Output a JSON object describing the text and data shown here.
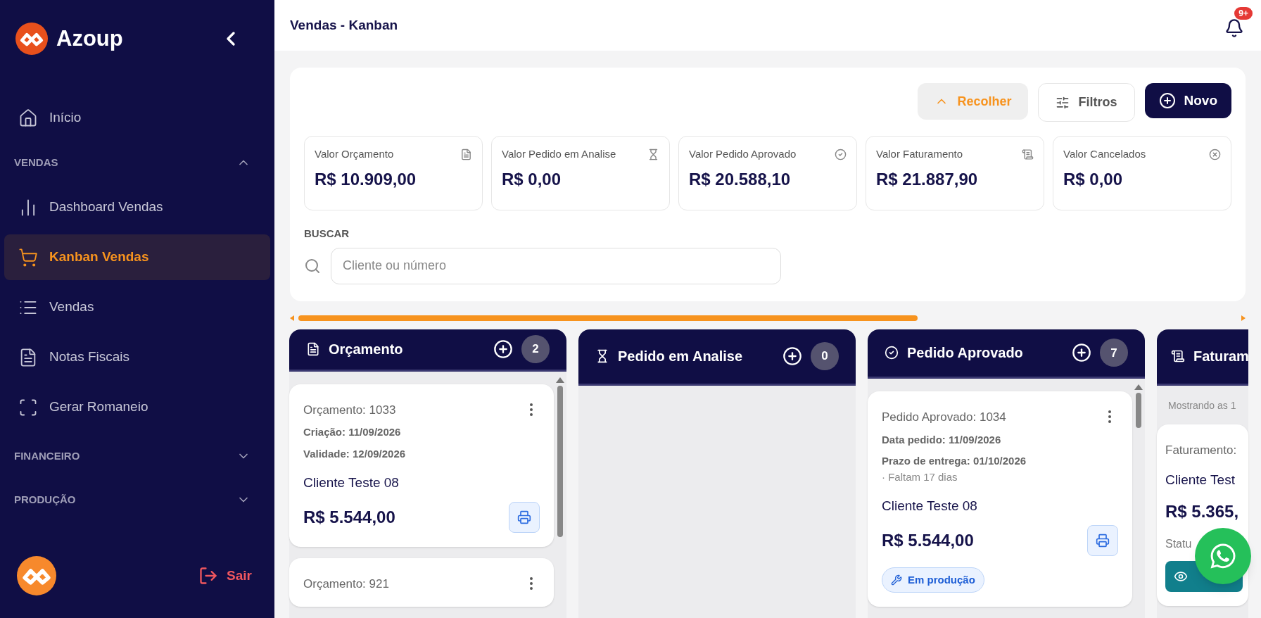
{
  "sidebar": {
    "brand": "Azoup",
    "top_items": [
      {
        "label": "Início",
        "selected": false
      }
    ],
    "sections": [
      {
        "title": "VENDAS",
        "expanded": true,
        "items": [
          {
            "label": "Dashboard Vendas",
            "selected": false
          },
          {
            "label": "Kanban Vendas",
            "selected": true
          },
          {
            "label": "Vendas",
            "selected": false
          },
          {
            "label": "Notas Fiscais",
            "selected": false
          },
          {
            "label": "Gerar Romaneio",
            "selected": false
          }
        ]
      },
      {
        "title": "FINANCEIRO",
        "expanded": false
      },
      {
        "title": "PRODUÇÃO",
        "expanded": false
      }
    ],
    "logout": "Sair"
  },
  "header": {
    "title": "Vendas - Kanban",
    "notifications_badge": "9+"
  },
  "toolbar": {
    "buttons": [
      {
        "label": "Recolher",
        "kind": "collapse"
      },
      {
        "label": "Filtros",
        "kind": "filter"
      },
      {
        "label": "Novo",
        "kind": "new"
      }
    ]
  },
  "summary_cards": [
    {
      "label": "Valor Orçamento",
      "value": "R$ 10.909,00"
    },
    {
      "label": "Valor Pedido em Analise",
      "value": "R$ 0,00"
    },
    {
      "label": "Valor Pedido Aprovado",
      "value": "R$ 20.588,10"
    },
    {
      "label": "Valor Faturamento",
      "value": "R$ 21.887,90"
    },
    {
      "label": "Valor Cancelados",
      "value": "R$ 0,00"
    }
  ],
  "search": {
    "label": "BUSCAR",
    "placeholder": "Cliente ou número"
  },
  "board_scroll": {
    "level": 0.66
  },
  "columns": [
    {
      "title": "Orçamento",
      "count": "2",
      "cards": [
        {
          "title": "Orçamento: 1033",
          "details": [
            "Criação: 11/09/2026",
            "Validade: 12/09/2026"
          ],
          "client": "Cliente Teste 08",
          "value": "R$ 5.544,00"
        },
        {
          "title": "Orçamento: 921"
        }
      ]
    },
    {
      "title": "Pedido em Analise",
      "count": "0"
    },
    {
      "title": "Pedido Aprovado",
      "count": "7",
      "cards": [
        {
          "title": "Pedido Aprovado: 1034",
          "details": [
            "Data pedido: 11/09/2026",
            "Prazo de entrega: 01/10/2026"
          ],
          "note": "· Faltam 17 dias",
          "client": "Cliente Teste 08",
          "value": "R$ 5.544,00",
          "badge": "Em produção"
        }
      ]
    },
    {
      "title": "Faturam",
      "info": "Mostrando as 1",
      "cards": [
        {
          "title": "Faturamento:",
          "client": "Cliente Test",
          "value": "R$ 5.365,",
          "status": "Statu"
        }
      ]
    }
  ]
}
